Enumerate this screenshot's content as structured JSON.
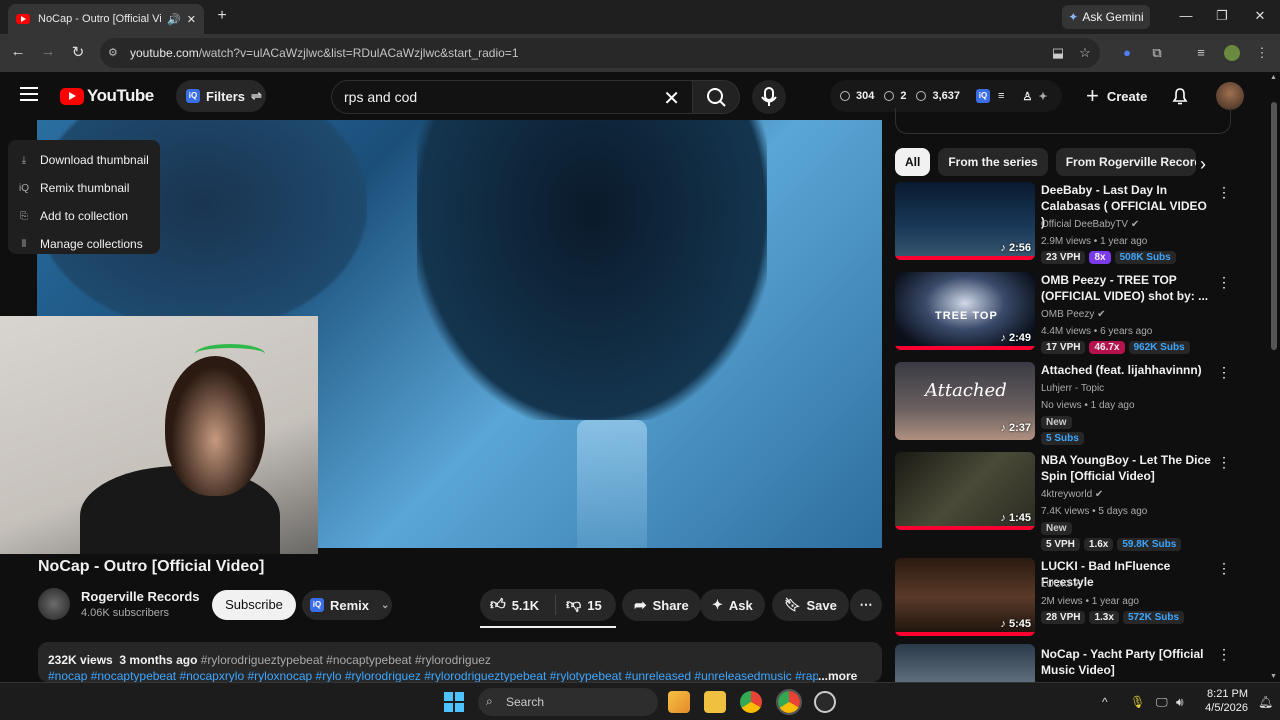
{
  "browser": {
    "tab_title": "NoCap - Outro [Official Vid",
    "speaker_icon": "speaker-icon",
    "new_tab_label": "+",
    "gemini_label": "Ask Gemini",
    "url_host": "youtube.com",
    "url_path": "/watch?v=ulACaWzjlwc&list=RDulACaWzjlwc&start_radio=1"
  },
  "header": {
    "logo_text": "YouTube",
    "filters_label": "Filters",
    "search_value": "rps and cod",
    "stats": [
      "304",
      "2",
      "3,637"
    ],
    "create_label": "Create"
  },
  "context_menu": {
    "items": [
      "Download thumbnail",
      "Remix thumbnail",
      "Add to collection",
      "Manage collections"
    ]
  },
  "video": {
    "title": "NoCap - Outro [Official Video]",
    "channel": "Rogerville Records",
    "subscribers": "4.06K subscribers",
    "subscribe_label": "Subscribe",
    "remix_label": "Remix",
    "likes": "5.1K",
    "dislikes": "15",
    "share_label": "Share",
    "ask_label": "Ask",
    "save_label": "Save",
    "views": "232K views",
    "age": "3 months ago",
    "tags_line1": "#rylorodrigueztypebeat #nocaptypebeat #rylorodriguez",
    "tags_line2": "#nocap #nocaptypebeat #nocapxrylo #ryloxnocap #rylo #rylorodriguez #rylorodrigueztypebeat #rylotypebeat #unreleased #unreleasedmusic #rap",
    "more_label": "...more"
  },
  "chips": [
    "All",
    "From the series",
    "From Rogerville Records"
  ],
  "recommendations": [
    {
      "title": "DeeBaby - Last Day In Calabasas ( OFFICIAL VIDEO )",
      "channel": "Official DeeBabyTV",
      "meta": "2.9M views • 1 year ago",
      "duration": "2:56",
      "badges": [
        "23 VPH",
        "8x",
        "508K Subs"
      ]
    },
    {
      "title": "OMB Peezy - TREE TOP (OFFICIAL VIDEO) shot by: ...",
      "channel": "OMB Peezy",
      "meta": "4.4M views • 6 years ago",
      "duration": "2:49",
      "badges": [
        "17 VPH",
        "46.7x",
        "962K Subs"
      ]
    },
    {
      "title": "Attached (feat. lijahhavinnn)",
      "channel": "Luhjerr - Topic",
      "meta": "No views • 1 day ago",
      "duration": "2:37",
      "badges": [
        "New",
        "5 Subs"
      ]
    },
    {
      "title": "NBA YoungBoy - Let The Dice Spin [Official Video]",
      "channel": "4ktreyworld",
      "meta": "7.4K views • 5 days ago",
      "duration": "1:45",
      "badges": [
        "New",
        "5 VPH",
        "1.6x",
        "59.8K Subs"
      ]
    },
    {
      "title": "LUCKI - Bad InFluence Freestyle",
      "channel": "LUCKI",
      "meta": "2M views • 1 year ago",
      "duration": "5:45",
      "badges": [
        "28 VPH",
        "1.3x",
        "572K Subs"
      ]
    },
    {
      "title": "NoCap - Yacht Party [Official Music Video]",
      "channel": "",
      "meta": "",
      "duration": "",
      "badges": []
    }
  ],
  "taskbar": {
    "search_label": "Search",
    "time": "8:21 PM",
    "date": "4/5/2026"
  }
}
